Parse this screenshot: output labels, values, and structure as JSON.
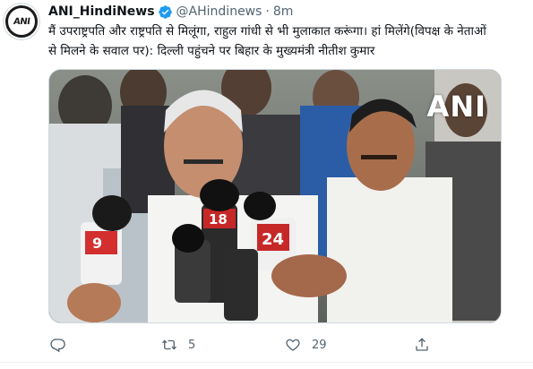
{
  "author": {
    "name": "ANI_HindiNews",
    "handle": "@AHindinews",
    "separator": "·",
    "time": "8m",
    "avatar_logo": "ANI",
    "verified_color": "#1d9bf0"
  },
  "tweet": {
    "text": "मैं उपराष्ट्रपति और राष्ट्रपति से मिलूंगा, राहुल गांधी से भी मुलाकात करूंगा। हां मिलेंगे(विपक्ष के नेताओं से मिलने के सवाल पर): दिल्ली पहुंचने पर बिहार के मुख्यमंत्री नीतीश कुमार"
  },
  "media": {
    "watermark": "ANI",
    "mic_labels": [
      "18",
      "24",
      "9"
    ]
  },
  "actions": {
    "reply_icon": "reply-icon",
    "retweet_icon": "retweet-icon",
    "retweet_count": "5",
    "like_icon": "heart-icon",
    "like_count": "29",
    "share_icon": "share-icon"
  },
  "colors": {
    "text": "#0f1419",
    "secondary": "#536471",
    "accent": "#1d9bf0"
  }
}
